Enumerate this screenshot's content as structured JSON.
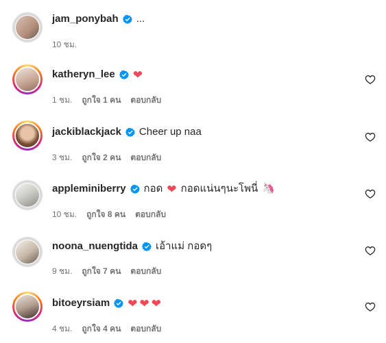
{
  "caption": {
    "username": "jam_ponybah",
    "text": "...",
    "time": "10 ชม."
  },
  "comments": [
    {
      "username": "katheryn_lee",
      "text": "",
      "hearts": 1,
      "time": "1 ชม.",
      "likes": "ถูกใจ 1 คน",
      "reply": "ตอบกลับ"
    },
    {
      "username": "jackiblackjack",
      "text": "Cheer up naa",
      "hearts": 0,
      "time": "3 ชม.",
      "likes": "ถูกใจ 2 คน",
      "reply": "ตอบกลับ"
    },
    {
      "username": "appleminiberry",
      "text_before": "กอด",
      "text_after": "กอดแน่นๆนะโพนี่",
      "emoji": "🦄",
      "time": "10 ชม.",
      "likes": "ถูกใจ 8 คน",
      "reply": "ตอบกลับ"
    },
    {
      "username": "noona_nuengtida",
      "text": "เอ้าแม่ กอดๆ",
      "time": "9 ชม.",
      "likes": "ถูกใจ 7 คน",
      "reply": "ตอบกลับ"
    },
    {
      "username": "bitoeyrsiam",
      "text": "",
      "hearts": 3,
      "time": "4 ชม.",
      "likes": "ถูกใจ 4 คน",
      "reply": "ตอบกลับ"
    }
  ],
  "icons": {
    "verified": "verified-badge-icon",
    "heart_outline": "heart-outline-icon",
    "heart_filled": "red-heart-emoji"
  },
  "colors": {
    "verified": "#0095f6",
    "heart": "#ed4956",
    "meta": "#737373"
  }
}
